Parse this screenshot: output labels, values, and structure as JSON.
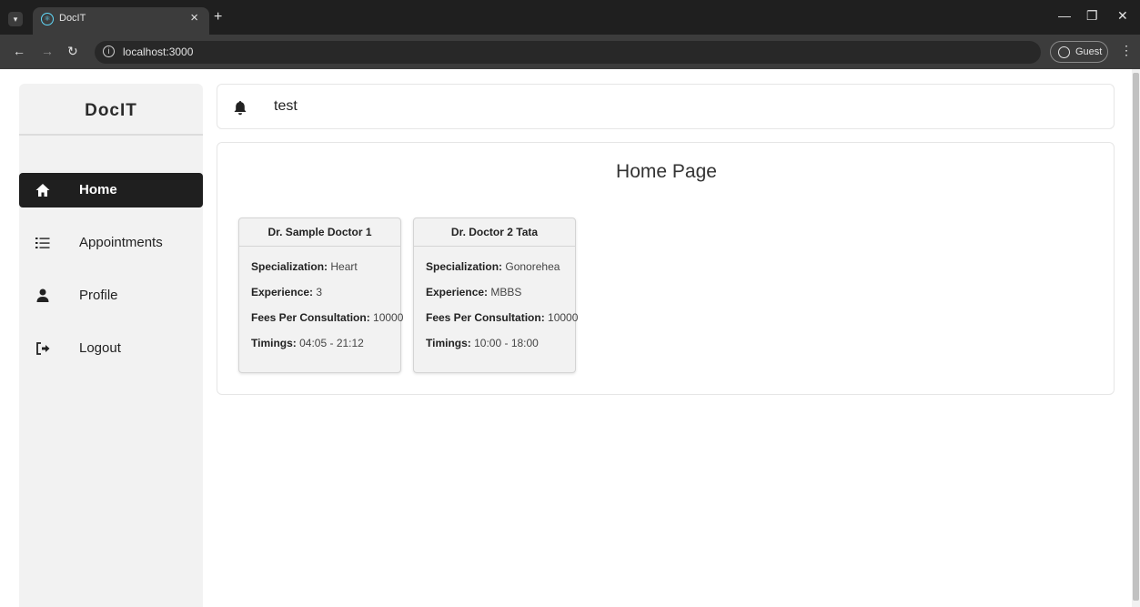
{
  "browser": {
    "tab_title": "DocIT",
    "tab_close_icon": "×",
    "new_tab_icon": "+",
    "url": "localhost:3000",
    "profile_label": "Guest"
  },
  "sidebar": {
    "logo": "DocIT",
    "items": [
      {
        "label": "Home",
        "icon": "home-icon",
        "active": true
      },
      {
        "label": "Appointments",
        "icon": "list-icon",
        "active": false
      },
      {
        "label": "Profile",
        "icon": "user-icon",
        "active": false
      },
      {
        "label": "Logout",
        "icon": "logout-icon",
        "active": false
      }
    ]
  },
  "header": {
    "user_name": "test",
    "icon": "bell-icon"
  },
  "main": {
    "title": "Home Page",
    "doctors": [
      {
        "name": "Dr. Sample Doctor 1",
        "specialization_label": "Specialization:",
        "specialization": "Heart",
        "experience_label": "Experience:",
        "experience": "3",
        "fees_label": "Fees Per Consultation:",
        "fees": "10000",
        "timings_label": "Timings:",
        "timings": "04:05 - 21:12"
      },
      {
        "name": "Dr. Doctor 2 Tata",
        "specialization_label": "Specialization:",
        "specialization": "Gonorehea",
        "experience_label": "Experience:",
        "experience": "MBBS",
        "fees_label": "Fees Per Consultation:",
        "fees": "10000",
        "timings_label": "Timings:",
        "timings": "10:00 - 18:00"
      }
    ]
  },
  "colors": {
    "active_menu_bg": "#1f1f1f",
    "sidebar_bg": "#f2f2f2",
    "card_bg": "#f2f2f2"
  }
}
